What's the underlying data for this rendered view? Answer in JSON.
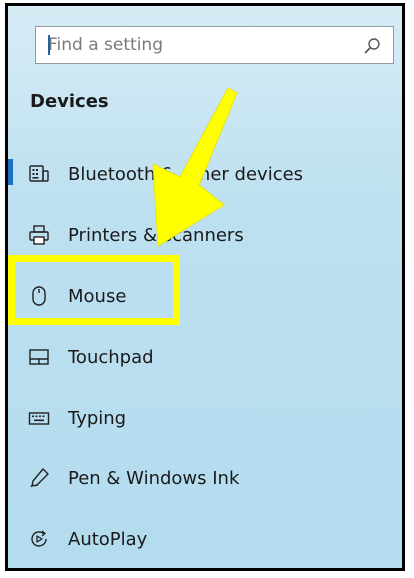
{
  "search": {
    "placeholder": "Find a setting",
    "icon": "search-icon"
  },
  "section": {
    "title": "Devices"
  },
  "nav": {
    "items": [
      {
        "label": "Bluetooth & other devices",
        "icon": "bluetooth-keyboard-icon",
        "selected": true
      },
      {
        "label": "Printers & scanners",
        "icon": "printer-icon",
        "selected": false
      },
      {
        "label": "Mouse",
        "icon": "mouse-icon",
        "selected": false,
        "highlighted": true
      },
      {
        "label": "Touchpad",
        "icon": "touchpad-icon",
        "selected": false
      },
      {
        "label": "Typing",
        "icon": "keyboard-icon",
        "selected": false
      },
      {
        "label": "Pen & Windows Ink",
        "icon": "pen-icon",
        "selected": false
      },
      {
        "label": "AutoPlay",
        "icon": "autoplay-icon",
        "selected": false
      }
    ]
  },
  "colors": {
    "accent": "#1d6fc4",
    "annotation": "#ffff00",
    "background": "#bde0f0"
  },
  "annotations": {
    "arrow_icon": "arrow-annotation-icon",
    "highlight": "highlight-box"
  }
}
